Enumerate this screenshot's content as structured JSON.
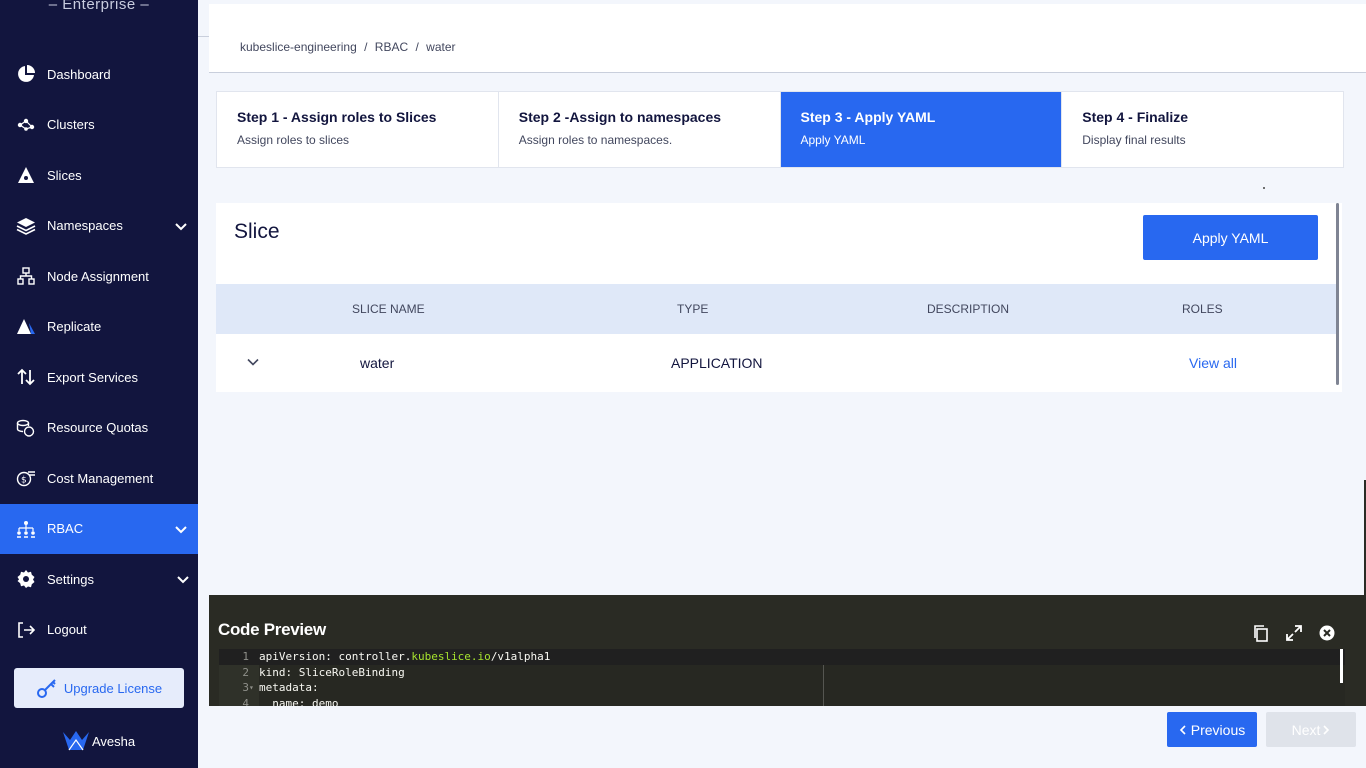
{
  "brand": {
    "subtitle": "– Enterprise –",
    "footer": "Avesha"
  },
  "sidebar": {
    "items": [
      {
        "label": "Dashboard",
        "icon": "pie-chart-icon"
      },
      {
        "label": "Clusters",
        "icon": "clusters-icon"
      },
      {
        "label": "Slices",
        "icon": "slices-icon"
      },
      {
        "label": "Namespaces",
        "icon": "layers-icon",
        "expandable": true
      },
      {
        "label": "Node Assignment",
        "icon": "node-tree-icon"
      },
      {
        "label": "Replicate",
        "icon": "replicate-icon"
      },
      {
        "label": "Export Services",
        "icon": "arrows-up-down-icon"
      },
      {
        "label": "Resource Quotas",
        "icon": "coins-icon"
      },
      {
        "label": "Cost Management",
        "icon": "money-icon"
      },
      {
        "label": "RBAC",
        "icon": "rbac-icon",
        "expandable": true,
        "active": true
      },
      {
        "label": "Settings",
        "icon": "gear-icon",
        "expandable": true
      },
      {
        "label": "Logout",
        "icon": "logout-icon"
      }
    ],
    "upgrade_label": "Upgrade License"
  },
  "breadcrumb": {
    "part1": "kubeslice-engineering",
    "part2": "RBAC",
    "part3": "water",
    "separator": "/"
  },
  "steps": [
    {
      "title": "Step 1 - Assign roles to Slices",
      "subtitle": "Assign roles to slices"
    },
    {
      "title": "Step 2 -Assign to namespaces",
      "subtitle": "Assign roles to namespaces."
    },
    {
      "title": "Step 3 - Apply YAML",
      "subtitle": "Apply YAML",
      "active": true
    },
    {
      "title": "Step 4 - Finalize",
      "subtitle": "Display final results"
    }
  ],
  "slice_card": {
    "title": "Slice",
    "apply_label": "Apply YAML",
    "columns": [
      "SLICE NAME",
      "TYPE",
      "DESCRIPTION",
      "ROLES"
    ],
    "row": {
      "name": "water",
      "type": "APPLICATION",
      "description": "",
      "roles_link": "View all"
    }
  },
  "code_preview": {
    "title": "Code Preview",
    "lines": [
      {
        "num": "1",
        "prefix": "apiVersion: controller.",
        "highlight": "kubeslice.io",
        "suffix": "/v1alpha1"
      },
      {
        "num": "2",
        "text": "kind: SliceRoleBinding"
      },
      {
        "num": "3",
        "text": "metadata:"
      },
      {
        "num": "4",
        "text": "  name: demo"
      }
    ]
  },
  "footer_buttons": {
    "previous": "Previous",
    "next": "Next"
  }
}
